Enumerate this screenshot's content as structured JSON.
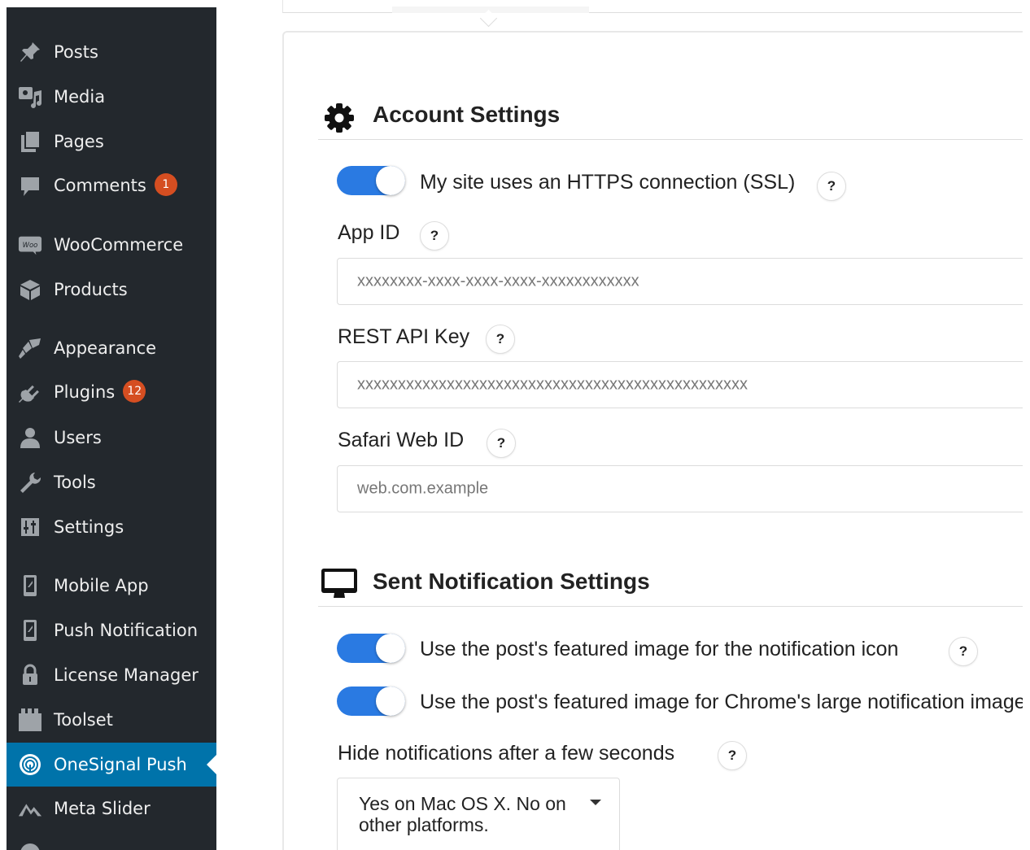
{
  "sidebar": {
    "items": [
      {
        "label": "Posts",
        "icon": "pin-icon"
      },
      {
        "label": "Media",
        "icon": "media-icon"
      },
      {
        "label": "Pages",
        "icon": "pages-icon"
      },
      {
        "label": "Comments",
        "icon": "comment-icon",
        "badge": "1"
      },
      {
        "label": "WooCommerce",
        "icon": "woo-icon"
      },
      {
        "label": "Products",
        "icon": "box-icon"
      },
      {
        "label": "Appearance",
        "icon": "brush-icon"
      },
      {
        "label": "Plugins",
        "icon": "plug-icon",
        "badge": "12"
      },
      {
        "label": "Users",
        "icon": "user-icon"
      },
      {
        "label": "Tools",
        "icon": "wrench-icon"
      },
      {
        "label": "Settings",
        "icon": "sliders-icon"
      },
      {
        "label": "Mobile App",
        "icon": "phone-icon"
      },
      {
        "label": "Push Notification",
        "icon": "phone-icon"
      },
      {
        "label": "License Manager",
        "icon": "lock-icon"
      },
      {
        "label": "Toolset",
        "icon": "toolset-icon"
      },
      {
        "label": "OneSignal Push",
        "icon": "onesignal-icon",
        "active": true
      },
      {
        "label": "Meta Slider",
        "icon": "mountain-icon"
      }
    ]
  },
  "account": {
    "title": "Account Settings",
    "https_label": "My site uses an HTTPS connection (SSL)",
    "https_on": true,
    "app_id_label": "App ID",
    "app_id_placeholder": "xxxxxxxx-xxxx-xxxx-xxxx-xxxxxxxxxxxx",
    "rest_key_label": "REST API Key",
    "rest_key_placeholder": "xxxxxxxxxxxxxxxxxxxxxxxxxxxxxxxxxxxxxxxxxxxxxxxx",
    "safari_label": "Safari Web ID",
    "safari_placeholder": "web.com.example"
  },
  "sent": {
    "title": "Sent Notification Settings",
    "icon_toggle_label": "Use the post's featured image for the notification icon",
    "icon_toggle_on": true,
    "large_toggle_label": "Use the post's featured image for Chrome's large notification image",
    "large_toggle_on": true,
    "hide_label": "Hide notifications after a few seconds",
    "hide_value": "Yes on Mac OS X. No on other platforms."
  },
  "help_glyph": "?",
  "colors": {
    "sidebar_bg": "#23282d",
    "active_bg": "#0073aa",
    "toggle_on": "#2a7ae2",
    "badge": "#d54e21"
  }
}
